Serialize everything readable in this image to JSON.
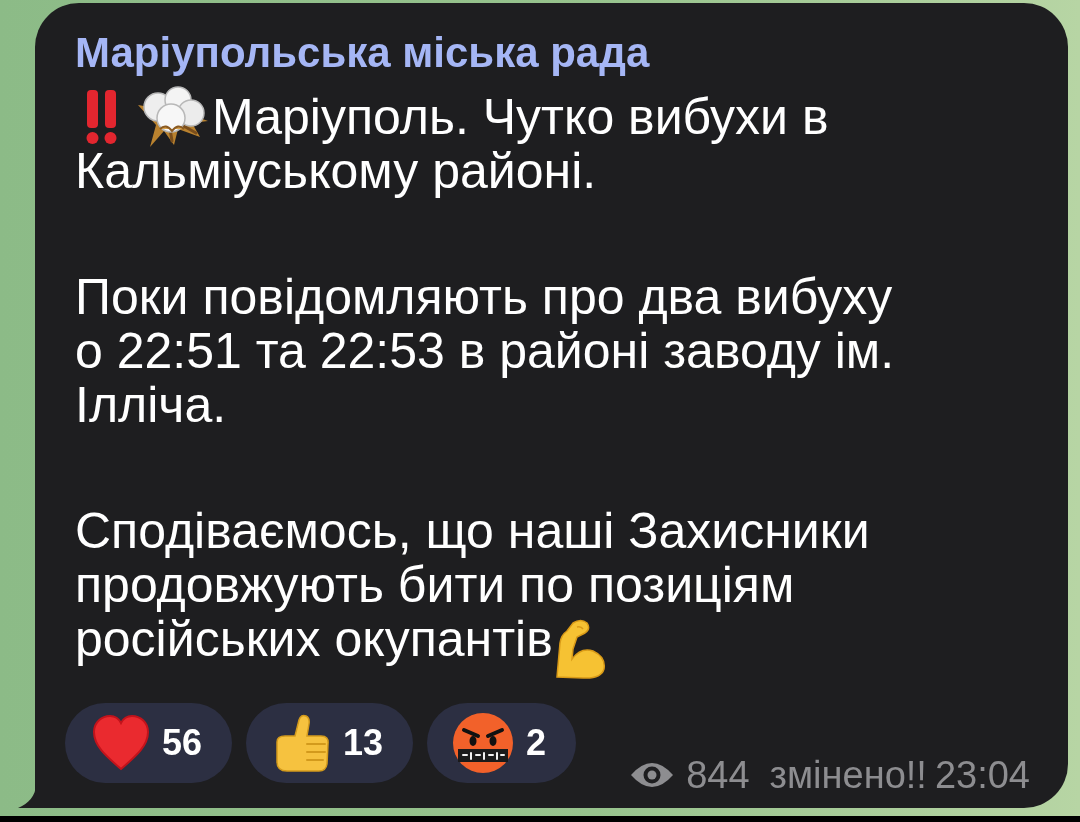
{
  "message": {
    "sender": "Маріупольська міська рада",
    "paragraphs": [
      {
        "lines": [
          {
            "kind": "lead",
            "text": "Маріуполь. Чутко вибухи в"
          },
          {
            "kind": "plain",
            "text": "Кальміуському районі."
          }
        ]
      },
      {
        "lines": [
          {
            "kind": "plain",
            "text": "Поки повідомляють про два вибуху"
          },
          {
            "kind": "plain",
            "text": "о 22:51 та 22:53 в районі заводу ім."
          },
          {
            "kind": "plain",
            "text": "Ілліча."
          }
        ]
      },
      {
        "lines": [
          {
            "kind": "plain",
            "text": "Сподіваємось, що наші Захисники"
          },
          {
            "kind": "plain",
            "text": "продовжують бити по позиціям"
          },
          {
            "kind": "trail",
            "text": "російських окупантів"
          }
        ]
      }
    ],
    "reactions": [
      {
        "kind": "heart",
        "count": "56"
      },
      {
        "kind": "thumbs",
        "count": "13"
      },
      {
        "kind": "cursing",
        "count": "2"
      }
    ],
    "views": "844",
    "edited": "змінено!!",
    "time": "23:04"
  }
}
